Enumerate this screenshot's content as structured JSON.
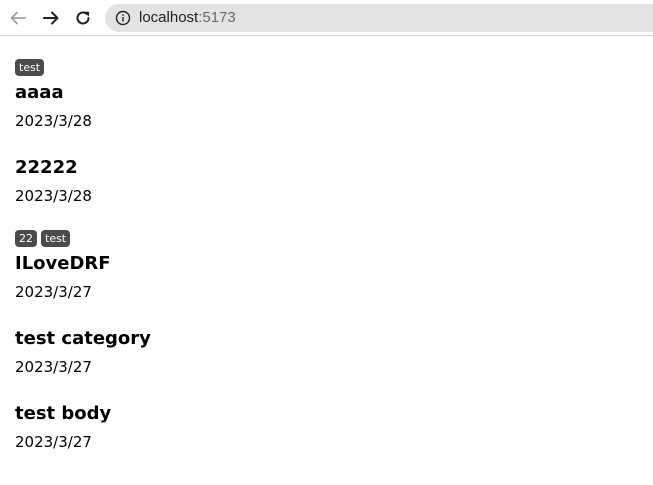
{
  "browser": {
    "url_host": "localhost",
    "url_port": ":5173"
  },
  "posts": [
    {
      "tags": [
        "test"
      ],
      "title": "aaaa",
      "date": "2023/3/28"
    },
    {
      "tags": [],
      "title": "22222",
      "date": "2023/3/28"
    },
    {
      "tags": [
        "22",
        "test"
      ],
      "title": "ILoveDRF",
      "date": "2023/3/27"
    },
    {
      "tags": [],
      "title": "test category",
      "date": "2023/3/27"
    },
    {
      "tags": [],
      "title": "test body",
      "date": "2023/3/27"
    }
  ]
}
